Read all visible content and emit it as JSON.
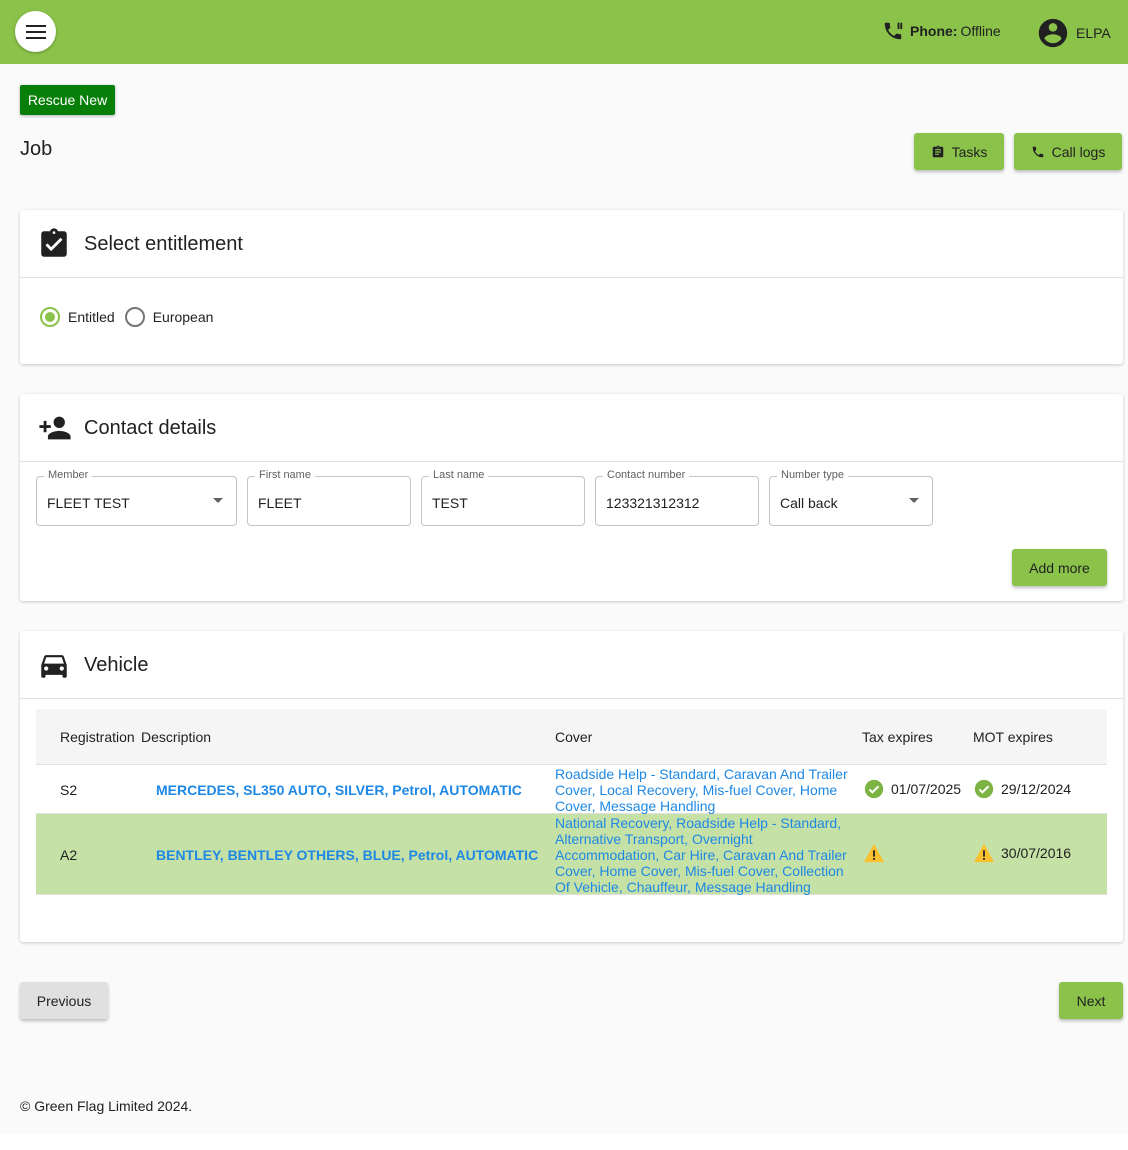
{
  "header": {
    "phone_label": "Phone:",
    "phone_status": "Offline",
    "user_name": "ELPA",
    "color": "#8bc34a"
  },
  "actions": {
    "rescue_new": "Rescue New",
    "tasks": "Tasks",
    "call_logs": "Call logs"
  },
  "page": {
    "title": "Job"
  },
  "entitlement": {
    "title": "Select entitlement",
    "options": [
      {
        "label": "Entitled",
        "selected": true
      },
      {
        "label": "European",
        "selected": false
      }
    ]
  },
  "contact": {
    "title": "Contact details",
    "fields": [
      {
        "label": "Member",
        "value": "FLEET TEST"
      },
      {
        "label": "First name",
        "value": "FLEET"
      },
      {
        "label": "Last name",
        "value": "TEST"
      },
      {
        "label": "Contact number",
        "value": "123321312312"
      },
      {
        "label": "Number type",
        "value": "Call back"
      }
    ],
    "add_more": "Add more"
  },
  "vehicle": {
    "title": "Vehicle",
    "columns": [
      "Registration",
      "Description",
      "Cover",
      "Tax expires",
      "MOT expires"
    ],
    "rows": [
      {
        "registration": "S2",
        "description": "MERCEDES, SL350 AUTO, SILVER, Petrol, AUTOMATIC",
        "cover": "Roadside Help - Standard, Caravan And Trailer Cover, Local Recovery, Mis-fuel Cover, Home Cover, Message Handling",
        "tax_expires": "01/07/2025",
        "tax_status": "check-circle-icon",
        "mot_expires": "29/12/2024",
        "mot_status": "check-circle-icon",
        "selected": false
      },
      {
        "registration": "A2",
        "description": "BENTLEY, BENTLEY OTHERS, BLUE, Petrol, AUTOMATIC",
        "cover": "National Recovery, Roadside Help - Standard, Alternative Transport, Overnight Accommodation, Car Hire, Caravan And Trailer Cover, Home Cover, Mis-fuel Cover, Collection Of Vehicle, Chauffeur, Message Handling",
        "tax_expires": "",
        "tax_status": "warning-icon",
        "mot_expires": "30/07/2016",
        "mot_status": "warning-icon",
        "selected": true
      }
    ]
  },
  "nav": {
    "previous": "Previous",
    "next": "Next"
  },
  "footer": {
    "copyright": "© Green Flag Limited 2024."
  }
}
